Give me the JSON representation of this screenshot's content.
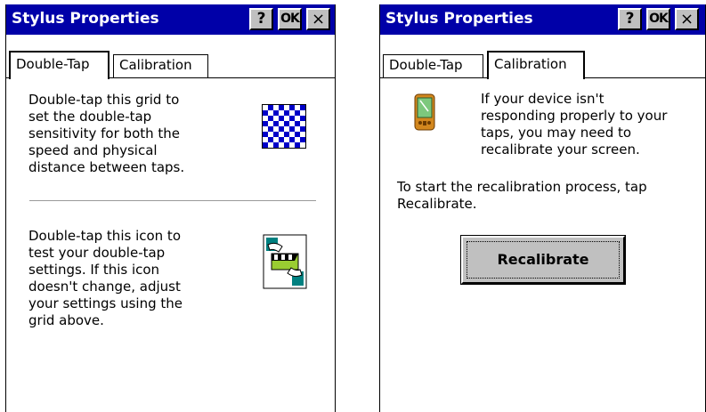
{
  "windows": [
    {
      "title": "Stylus Properties",
      "buttons": {
        "help": "?",
        "ok": "OK",
        "close": "×"
      },
      "tabs": [
        {
          "label": "Double-Tap"
        },
        {
          "label": "Calibration"
        }
      ],
      "active_tab": "Double-Tap",
      "content": {
        "grid_text": [
          "Double-tap this grid to",
          "set the double-tap",
          "sensitivity for both the",
          "speed and physical",
          "distance between taps."
        ],
        "icon_text": [
          "Double-tap this icon to",
          "test your double-tap",
          "settings. If this icon",
          "doesn't change, adjust",
          "your settings using the",
          "grid above."
        ],
        "grid_icon": "checkerboard-grid-icon",
        "test_icon": "clapperboard-test-icon"
      }
    },
    {
      "title": "Stylus Properties",
      "buttons": {
        "help": "?",
        "ok": "OK",
        "close": "×"
      },
      "tabs": [
        {
          "label": "Double-Tap"
        },
        {
          "label": "Calibration"
        }
      ],
      "active_tab": "Calibration",
      "content": {
        "device_text": [
          "If your device isn't",
          "responding properly to your",
          "taps, you may need to",
          "recalibrate your screen."
        ],
        "instruction_text": [
          "To start the recalibration process, tap",
          "Recalibrate."
        ],
        "recalibrate_label": "Recalibrate",
        "device_icon": "pda-device-icon"
      }
    }
  ],
  "colors": {
    "titlebar": "#0000a8",
    "grid": "#0000c8",
    "button_face": "#c0c0c0"
  }
}
